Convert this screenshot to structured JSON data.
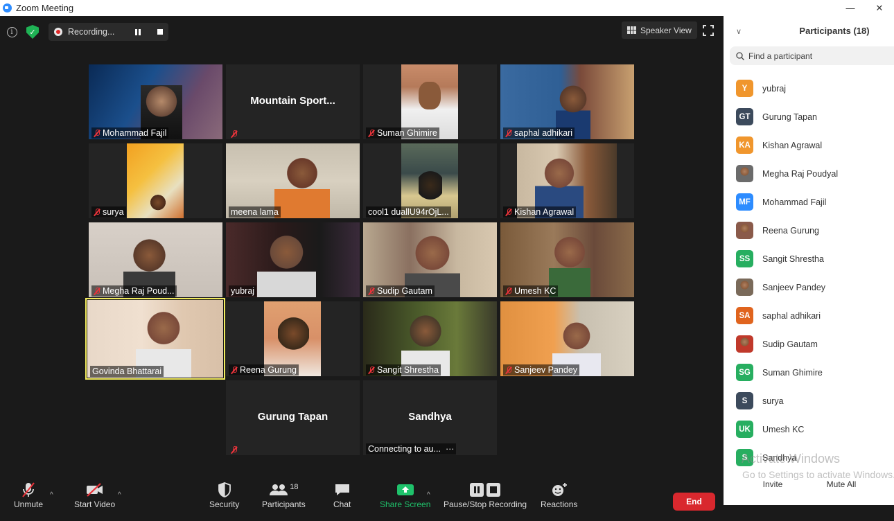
{
  "window": {
    "title": "Zoom Meeting",
    "minimize": "—",
    "close": "✕"
  },
  "topbar": {
    "recording_label": "Recording...",
    "view_label": "Speaker View"
  },
  "tiles": [
    {
      "name": "Mohammad Fajil"
    },
    {
      "name": "",
      "center_name": "Mountain Sport..."
    },
    {
      "name": "Suman Ghimire"
    },
    {
      "name": "saphal adhikari"
    },
    {
      "name": "surya"
    },
    {
      "name": "meena lama"
    },
    {
      "name": "cool1 duallU94rOjL..."
    },
    {
      "name": "Kishan Agrawal"
    },
    {
      "name": "Megha Raj Poud..."
    },
    {
      "name": "yubraj"
    },
    {
      "name": "Sudip Gautam"
    },
    {
      "name": "Umesh KC"
    },
    {
      "name": "Govinda Bhattarai"
    },
    {
      "name": "Reena Gurung"
    },
    {
      "name": "Sangit Shrestha"
    },
    {
      "name": "Sanjeev Pandey"
    },
    {
      "name": "",
      "center_name": "Gurung Tapan"
    },
    {
      "name": "Connecting to au...",
      "center_name": "Sandhya"
    }
  ],
  "toolbar": {
    "unmute": "Unmute",
    "start_video": "Start Video",
    "security": "Security",
    "participants": "Participants",
    "participants_count": "18",
    "chat": "Chat",
    "share_screen": "Share Screen",
    "recording": "Pause/Stop Recording",
    "reactions": "Reactions",
    "end": "End"
  },
  "panel": {
    "title": "Participants (18)",
    "search_placeholder": "Find a participant",
    "participants": [
      {
        "initials": "Y",
        "name": "yubraj",
        "color": "#f0962d"
      },
      {
        "initials": "GT",
        "name": "Gurung Tapan",
        "color": "#3c4a5c"
      },
      {
        "initials": "KA",
        "name": "Kishan Agrawal",
        "color": "#f0962d"
      },
      {
        "initials": "",
        "name": "Megha Raj Poudyal",
        "color": "#6b6b6b"
      },
      {
        "initials": "MF",
        "name": "Mohammad Fajil",
        "color": "#2d8cff"
      },
      {
        "initials": "",
        "name": "Reena Gurung",
        "color": "#8a5a4a"
      },
      {
        "initials": "SS",
        "name": "Sangit Shrestha",
        "color": "#27ae60"
      },
      {
        "initials": "",
        "name": "Sanjeev Pandey",
        "color": "#7a6a5a"
      },
      {
        "initials": "SA",
        "name": "saphal adhikari",
        "color": "#e0641e"
      },
      {
        "initials": "",
        "name": "Sudip Gautam",
        "color": "#c0392b"
      },
      {
        "initials": "SG",
        "name": "Suman Ghimire",
        "color": "#27ae60"
      },
      {
        "initials": "S",
        "name": "surya",
        "color": "#3c4a5c"
      },
      {
        "initials": "UK",
        "name": "Umesh KC",
        "color": "#27ae60"
      },
      {
        "initials": "S",
        "name": "Sandhya",
        "color": "#27ae60"
      }
    ],
    "invite": "Invite",
    "mute_all": "Mute All"
  },
  "watermark": {
    "line1": "Activate Windows",
    "line2": "Go to Settings to activate Windows."
  }
}
